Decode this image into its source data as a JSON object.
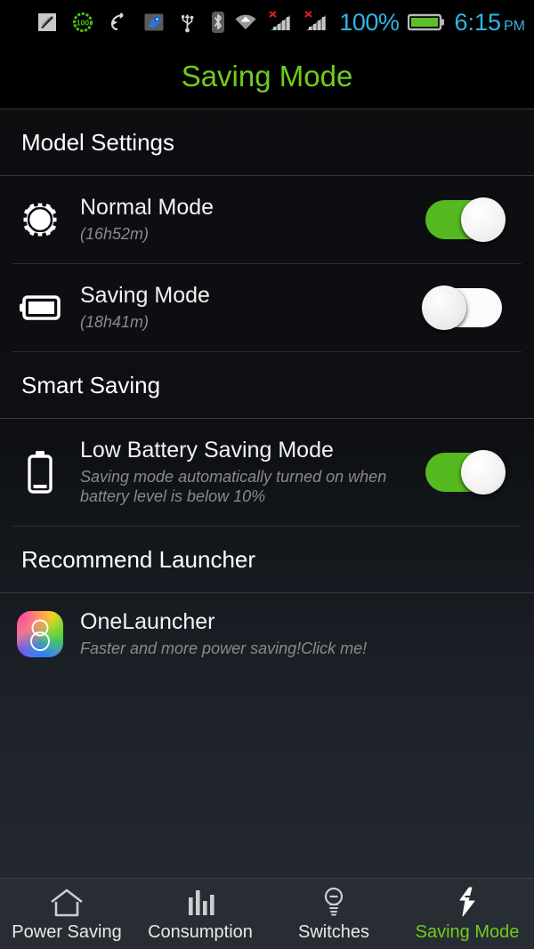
{
  "statusbar": {
    "icons": [
      {
        "name": "screenshot-pen-icon"
      },
      {
        "name": "battery-100-badge-icon",
        "label": "100"
      },
      {
        "name": "gesture-swipe-icon"
      },
      {
        "name": "blue-app-icon"
      },
      {
        "name": "usb-icon"
      },
      {
        "name": "bluetooth-icon"
      },
      {
        "name": "wifi-icon"
      },
      {
        "name": "signal-no-sim-1-icon"
      },
      {
        "name": "signal-no-sim-2-icon"
      }
    ],
    "battery_percent": "100%",
    "battery_icon": "battery-full-icon",
    "time": "6:15",
    "ampm": "PM",
    "accent_color": "#33b5e5"
  },
  "header": {
    "title": "Saving Mode",
    "title_color": "#6fcc1f"
  },
  "sections": [
    {
      "header": "Model Settings",
      "rows": [
        {
          "icon": "brightness-gear-icon",
          "title": "Normal Mode",
          "subtitle": "(16h52m)",
          "toggle": "on"
        },
        {
          "icon": "battery-horizontal-icon",
          "title": "Saving Mode",
          "subtitle": "(18h41m)",
          "toggle": "off"
        }
      ]
    },
    {
      "header": "Smart Saving",
      "rows": [
        {
          "icon": "battery-vertical-low-icon",
          "title": "Low Battery Saving Mode",
          "subtitle": "Saving mode automatically turned on when battery level is below 10%",
          "toggle": "on"
        }
      ]
    },
    {
      "header": "Recommend Launcher",
      "rows": [
        {
          "icon": "onelauncher-app-icon",
          "title": "OneLauncher",
          "subtitle": "Faster and more power saving!Click me!"
        }
      ]
    }
  ],
  "navbar": {
    "items": [
      {
        "label": "Power Saving",
        "icon": "home-icon",
        "active": false
      },
      {
        "label": "Consumption",
        "icon": "bar-chart-icon",
        "active": false
      },
      {
        "label": "Switches",
        "icon": "lightbulb-icon",
        "active": false
      },
      {
        "label": "Saving Mode",
        "icon": "lightning-bolt-icon",
        "active": true
      }
    ],
    "active_color": "#6fcc1f"
  },
  "colors": {
    "toggle_on": "#55b91f",
    "toggle_off_track": "#fbfbfb",
    "accent_green": "#6fcc1f",
    "status_blue": "#33b5e5"
  }
}
